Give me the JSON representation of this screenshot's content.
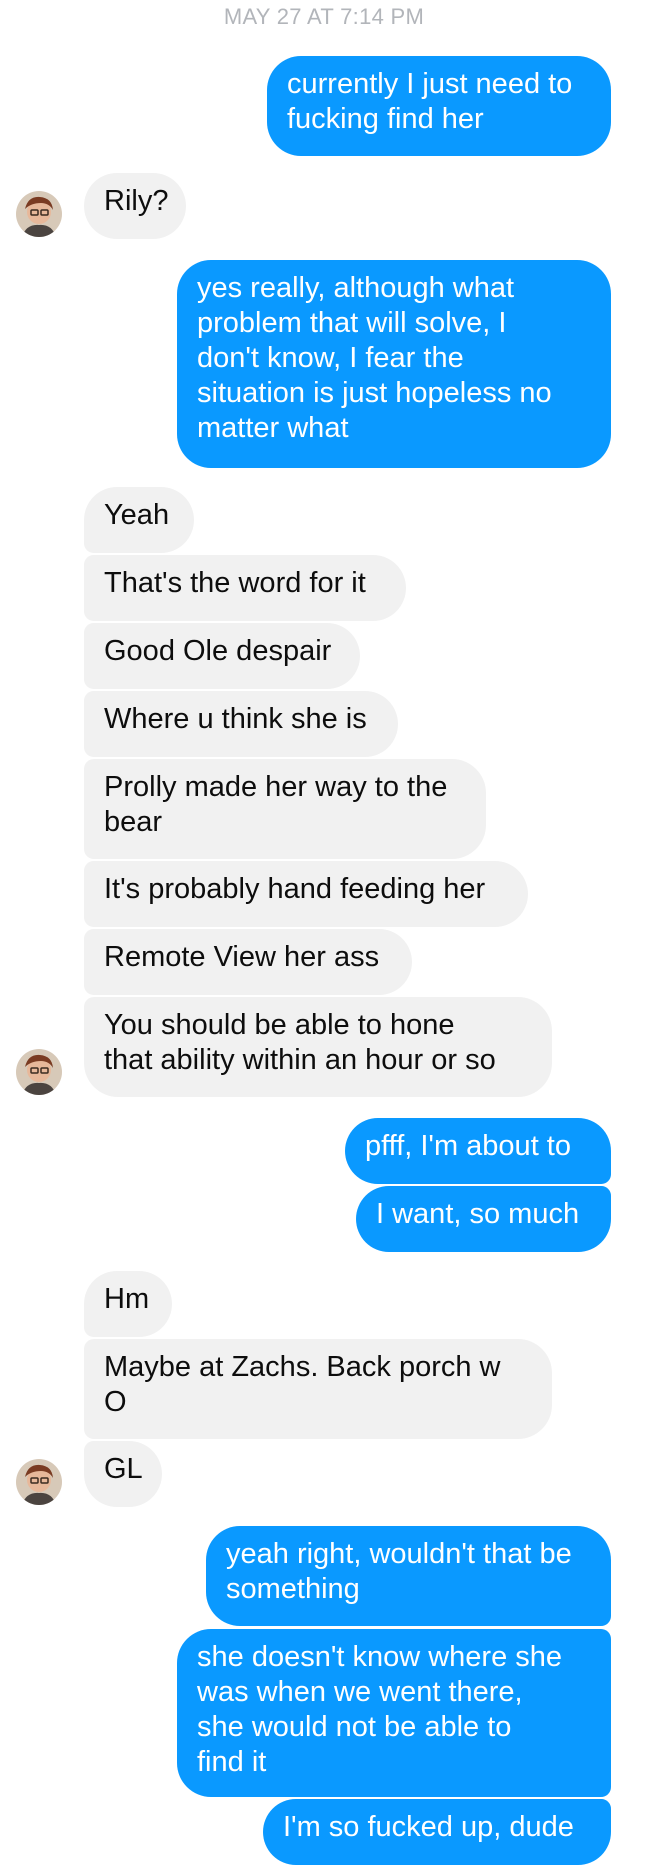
{
  "thread": {
    "timestamp": "MAY 27 AT 7:14 PM",
    "colors": {
      "outgoing": "#0a99ff",
      "incoming": "#f1f1f1",
      "timestamp": "#b2b5ba"
    },
    "messages": [
      {
        "dir": "out",
        "lines": [
          "currently I just need to",
          "fucking find her"
        ]
      },
      {
        "dir": "in",
        "lines": [
          "Rily?"
        ]
      },
      {
        "dir": "out",
        "lines": [
          "yes really, although what",
          "problem that will solve, I",
          "don't know, I fear the",
          "situation is just hopeless no",
          "matter what"
        ]
      },
      {
        "dir": "in",
        "lines": [
          "Yeah"
        ]
      },
      {
        "dir": "in",
        "lines": [
          "That's the word for it"
        ]
      },
      {
        "dir": "in",
        "lines": [
          "Good Ole despair"
        ]
      },
      {
        "dir": "in",
        "lines": [
          "Where u think she is"
        ]
      },
      {
        "dir": "in",
        "lines": [
          "Prolly made her way to the",
          "bear"
        ]
      },
      {
        "dir": "in",
        "lines": [
          "It's probably hand feeding her"
        ]
      },
      {
        "dir": "in",
        "lines": [
          "Remote View her ass"
        ]
      },
      {
        "dir": "in",
        "lines": [
          "You should be able to hone",
          "that ability within an hour or so"
        ]
      },
      {
        "dir": "out",
        "lines": [
          "pfff, I'm about to"
        ]
      },
      {
        "dir": "out",
        "lines": [
          "I want, so much"
        ]
      },
      {
        "dir": "in",
        "lines": [
          "Hm"
        ]
      },
      {
        "dir": "in",
        "lines": [
          "Maybe at Zachs. Back porch w",
          "O"
        ]
      },
      {
        "dir": "in",
        "lines": [
          "GL"
        ]
      },
      {
        "dir": "out",
        "lines": [
          "yeah right, wouldn't that be",
          "something"
        ]
      },
      {
        "dir": "out",
        "lines": [
          "she doesn't know where she",
          "was when we went there,",
          "she would not be able to",
          "find it"
        ]
      },
      {
        "dir": "out",
        "lines": [
          "I'm so fucked up, dude"
        ]
      }
    ]
  }
}
